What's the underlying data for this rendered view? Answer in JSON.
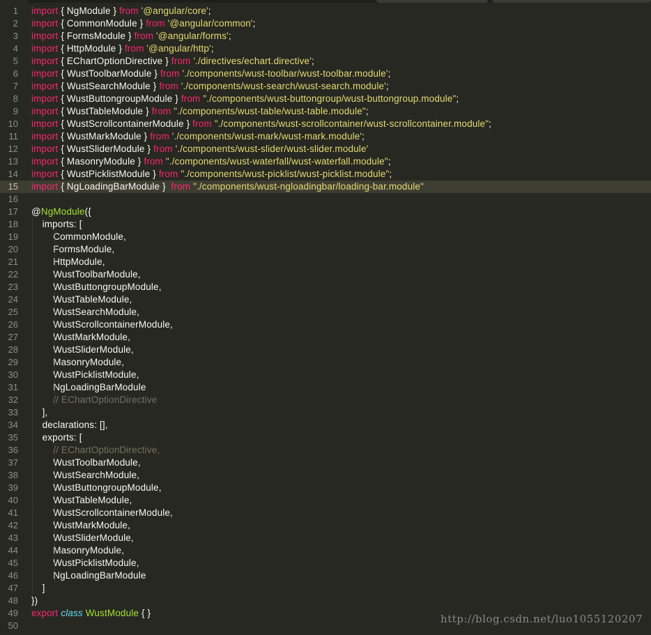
{
  "editor": {
    "watermark": "http://blog.csdn.net/luo1055120207",
    "current_line": 15,
    "theme_colors": {
      "background": "#272822",
      "keyword": "#f92672",
      "string": "#e6db74",
      "plain": "#f8f8f2",
      "decorator": "#a6e22e",
      "class_keyword": "#66d9ef",
      "comment": "#75715e",
      "line_number": "#90908a",
      "current_line_bg": "#3e3d32"
    }
  },
  "lines": [
    {
      "n": "1",
      "tokens": [
        [
          "kw",
          "import"
        ],
        [
          "plain",
          " { NgModule } "
        ],
        [
          "kw",
          "from"
        ],
        [
          "plain",
          " "
        ],
        [
          "str",
          "'@angular/core'"
        ],
        [
          "plain",
          ";"
        ]
      ]
    },
    {
      "n": "2",
      "tokens": [
        [
          "kw",
          "import"
        ],
        [
          "plain",
          " { CommonModule } "
        ],
        [
          "kw",
          "from"
        ],
        [
          "plain",
          " "
        ],
        [
          "str",
          "'@angular/common'"
        ],
        [
          "plain",
          ";"
        ]
      ]
    },
    {
      "n": "3",
      "tokens": [
        [
          "kw",
          "import"
        ],
        [
          "plain",
          " { FormsModule } "
        ],
        [
          "kw",
          "from"
        ],
        [
          "plain",
          " "
        ],
        [
          "str",
          "'@angular/forms'"
        ],
        [
          "plain",
          ";"
        ]
      ]
    },
    {
      "n": "4",
      "tokens": [
        [
          "kw",
          "import"
        ],
        [
          "plain",
          " { HttpModule } "
        ],
        [
          "kw",
          "from"
        ],
        [
          "plain",
          " "
        ],
        [
          "str",
          "'@angular/http'"
        ],
        [
          "plain",
          ";"
        ]
      ]
    },
    {
      "n": "5",
      "tokens": [
        [
          "kw",
          "import"
        ],
        [
          "plain",
          " { EChartOptionDirective } "
        ],
        [
          "kw",
          "from"
        ],
        [
          "plain",
          " "
        ],
        [
          "str",
          "'./directives/echart.directive'"
        ],
        [
          "plain",
          ";"
        ]
      ]
    },
    {
      "n": "6",
      "tokens": [
        [
          "kw",
          "import"
        ],
        [
          "plain",
          " { WustToolbarModule } "
        ],
        [
          "kw",
          "from"
        ],
        [
          "plain",
          " "
        ],
        [
          "str",
          "'./components/wust-toolbar/wust-toolbar.module'"
        ],
        [
          "plain",
          ";"
        ]
      ]
    },
    {
      "n": "7",
      "tokens": [
        [
          "kw",
          "import"
        ],
        [
          "plain",
          " { WustSearchModule } "
        ],
        [
          "kw",
          "from"
        ],
        [
          "plain",
          " "
        ],
        [
          "str",
          "'./components/wust-search/wust-search.module'"
        ],
        [
          "plain",
          ";"
        ]
      ]
    },
    {
      "n": "8",
      "tokens": [
        [
          "kw",
          "import"
        ],
        [
          "plain",
          " { WustButtongroupModule } "
        ],
        [
          "kw",
          "from"
        ],
        [
          "plain",
          " "
        ],
        [
          "str",
          "\"./components/wust-buttongroup/wust-buttongroup.module\""
        ],
        [
          "plain",
          ";"
        ]
      ]
    },
    {
      "n": "9",
      "tokens": [
        [
          "kw",
          "import"
        ],
        [
          "plain",
          " { WustTableModule } "
        ],
        [
          "kw",
          "from"
        ],
        [
          "plain",
          " "
        ],
        [
          "str",
          "\"./components/wust-table/wust-table.module\""
        ],
        [
          "plain",
          ";"
        ]
      ]
    },
    {
      "n": "10",
      "tokens": [
        [
          "kw",
          "import"
        ],
        [
          "plain",
          " { WustScrollcontainerModule } "
        ],
        [
          "kw",
          "from"
        ],
        [
          "plain",
          " "
        ],
        [
          "str",
          "\"./components/wust-scrollcontainer/wust-scrollcontainer.module\""
        ],
        [
          "plain",
          ";"
        ]
      ]
    },
    {
      "n": "11",
      "tokens": [
        [
          "kw",
          "import"
        ],
        [
          "plain",
          " { WustMarkModule } "
        ],
        [
          "kw",
          "from"
        ],
        [
          "plain",
          " "
        ],
        [
          "str",
          "'./components/wust-mark/wust-mark.module'"
        ],
        [
          "plain",
          ";"
        ]
      ]
    },
    {
      "n": "12",
      "tokens": [
        [
          "kw",
          "import"
        ],
        [
          "plain",
          " { WustSliderModule } "
        ],
        [
          "kw",
          "from"
        ],
        [
          "plain",
          " "
        ],
        [
          "str",
          "'./components/wust-slider/wust-slider.module'"
        ]
      ]
    },
    {
      "n": "13",
      "tokens": [
        [
          "kw",
          "import"
        ],
        [
          "plain",
          " { MasonryModule } "
        ],
        [
          "kw",
          "from"
        ],
        [
          "plain",
          " "
        ],
        [
          "str",
          "\"./components/wust-waterfall/wust-waterfall.module\""
        ],
        [
          "plain",
          ";"
        ]
      ]
    },
    {
      "n": "14",
      "tokens": [
        [
          "kw",
          "import"
        ],
        [
          "plain",
          " { WustPicklistModule } "
        ],
        [
          "kw",
          "from"
        ],
        [
          "plain",
          " "
        ],
        [
          "str",
          "\"./components/wust-picklist/wust-picklist.module\""
        ],
        [
          "plain",
          ";"
        ]
      ]
    },
    {
      "n": "15",
      "tokens": [
        [
          "kw",
          "import"
        ],
        [
          "plain",
          " { NgLoadingBarModule }  "
        ],
        [
          "kw",
          "from"
        ],
        [
          "plain",
          " "
        ],
        [
          "str",
          "\"./components/wust-ngloadingbar/loading-bar.module\""
        ]
      ]
    },
    {
      "n": "16",
      "tokens": []
    },
    {
      "n": "17",
      "tokens": [
        [
          "plain",
          "@"
        ],
        [
          "dec",
          "NgModule"
        ],
        [
          "plain",
          "({"
        ]
      ]
    },
    {
      "n": "18",
      "tokens": [
        [
          "plain",
          "    imports: ["
        ]
      ]
    },
    {
      "n": "19",
      "tokens": [
        [
          "plain",
          "        CommonModule,"
        ]
      ]
    },
    {
      "n": "20",
      "tokens": [
        [
          "plain",
          "        FormsModule,"
        ]
      ]
    },
    {
      "n": "21",
      "tokens": [
        [
          "plain",
          "        HttpModule,"
        ]
      ]
    },
    {
      "n": "22",
      "tokens": [
        [
          "plain",
          "        WustToolbarModule,"
        ]
      ]
    },
    {
      "n": "23",
      "tokens": [
        [
          "plain",
          "        WustButtongroupModule,"
        ]
      ]
    },
    {
      "n": "24",
      "tokens": [
        [
          "plain",
          "        WustTableModule,"
        ]
      ]
    },
    {
      "n": "25",
      "tokens": [
        [
          "plain",
          "        WustSearchModule,"
        ]
      ]
    },
    {
      "n": "26",
      "tokens": [
        [
          "plain",
          "        WustScrollcontainerModule,"
        ]
      ]
    },
    {
      "n": "27",
      "tokens": [
        [
          "plain",
          "        WustMarkModule,"
        ]
      ]
    },
    {
      "n": "28",
      "tokens": [
        [
          "plain",
          "        WustSliderModule,"
        ]
      ]
    },
    {
      "n": "29",
      "tokens": [
        [
          "plain",
          "        MasonryModule,"
        ]
      ]
    },
    {
      "n": "30",
      "tokens": [
        [
          "plain",
          "        WustPicklistModule,"
        ]
      ]
    },
    {
      "n": "31",
      "tokens": [
        [
          "plain",
          "        NgLoadingBarModule"
        ]
      ]
    },
    {
      "n": "32",
      "tokens": [
        [
          "plain",
          "        "
        ],
        [
          "com",
          "// EChartOptionDirective"
        ]
      ]
    },
    {
      "n": "33",
      "tokens": [
        [
          "plain",
          "    ],"
        ]
      ]
    },
    {
      "n": "34",
      "tokens": [
        [
          "plain",
          "    declarations: [],"
        ]
      ]
    },
    {
      "n": "35",
      "tokens": [
        [
          "plain",
          "    exports: ["
        ]
      ]
    },
    {
      "n": "36",
      "tokens": [
        [
          "plain",
          "        "
        ],
        [
          "com",
          "// EChartOptionDirective,"
        ]
      ]
    },
    {
      "n": "37",
      "tokens": [
        [
          "plain",
          "        WustToolbarModule,"
        ]
      ]
    },
    {
      "n": "38",
      "tokens": [
        [
          "plain",
          "        WustSearchModule,"
        ]
      ]
    },
    {
      "n": "39",
      "tokens": [
        [
          "plain",
          "        WustButtongroupModule,"
        ]
      ]
    },
    {
      "n": "40",
      "tokens": [
        [
          "plain",
          "        WustTableModule,"
        ]
      ]
    },
    {
      "n": "41",
      "tokens": [
        [
          "plain",
          "        WustScrollcontainerModule,"
        ]
      ]
    },
    {
      "n": "42",
      "tokens": [
        [
          "plain",
          "        WustMarkModule,"
        ]
      ]
    },
    {
      "n": "43",
      "tokens": [
        [
          "plain",
          "        WustSliderModule,"
        ]
      ]
    },
    {
      "n": "44",
      "tokens": [
        [
          "plain",
          "        MasonryModule,"
        ]
      ]
    },
    {
      "n": "45",
      "tokens": [
        [
          "plain",
          "        WustPicklistModule,"
        ]
      ]
    },
    {
      "n": "46",
      "tokens": [
        [
          "plain",
          "        NgLoadingBarModule"
        ]
      ]
    },
    {
      "n": "47",
      "tokens": [
        [
          "plain",
          "    ]"
        ]
      ]
    },
    {
      "n": "48",
      "tokens": [
        [
          "plain",
          "})"
        ]
      ]
    },
    {
      "n": "49",
      "tokens": [
        [
          "kw",
          "export"
        ],
        [
          "plain",
          " "
        ],
        [
          "cls",
          "class"
        ],
        [
          "plain",
          " "
        ],
        [
          "dec",
          "WustModule"
        ],
        [
          "plain",
          " { }"
        ]
      ]
    },
    {
      "n": "50",
      "tokens": []
    }
  ]
}
